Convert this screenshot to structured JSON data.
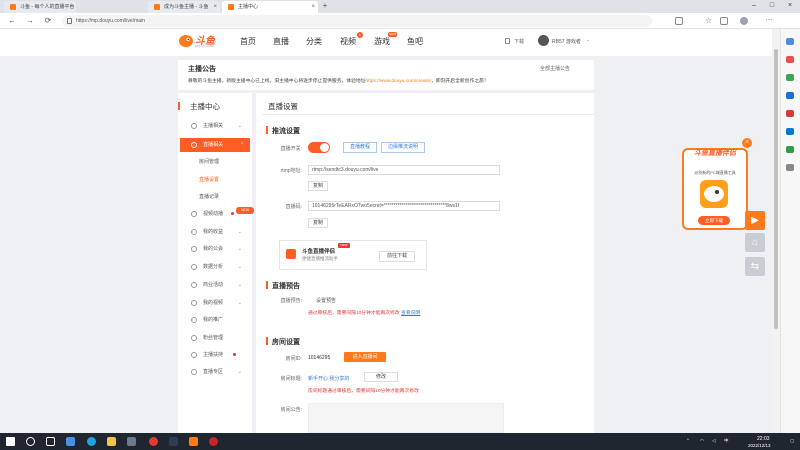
{
  "browser": {
    "tabs": [
      {
        "label": "斗鱼 - 每个人的直播平台"
      },
      {
        "label": "成为斗鱼主播 - 斗鱼"
      },
      {
        "label": "主播中心"
      }
    ],
    "url": "https://mp.douyu.com/live/main",
    "download_label": "下载",
    "profile_label": "RB57 游戏者"
  },
  "site": {
    "logo_text": "斗鱼",
    "logo_sub": "DOUYU.COM",
    "nav": [
      {
        "label": "首页"
      },
      {
        "label": "直播"
      },
      {
        "label": "分类"
      },
      {
        "label": "视频",
        "badge": "6"
      },
      {
        "label": "游戏",
        "badge": "NEW"
      },
      {
        "label": "鱼吧"
      }
    ]
  },
  "announcement": {
    "title": "主播公告",
    "text": "尊敬的斗鱼主播，新版主播中心已上线，旧主播中心将逐步停止提供服务，体验地址",
    "link": "https://www.douyu.com/creator",
    "tail": "，即刻开启全新创作之旅！",
    "view_all": "全部主播公告"
  },
  "sidebar": {
    "title": "主播中心",
    "items": [
      {
        "label": "主播相关",
        "icon": "user-icon"
      },
      {
        "label": "直播相关",
        "icon": "live-icon",
        "active": true
      },
      {
        "label": "视频动播",
        "icon": "video-icon"
      },
      {
        "label": "我的收益",
        "icon": "coin-icon"
      },
      {
        "label": "我的公会",
        "icon": "guild-icon"
      },
      {
        "label": "数据分析",
        "icon": "chart-icon"
      },
      {
        "label": "商业活动",
        "icon": "gift-icon"
      },
      {
        "label": "我的视频",
        "icon": "film-icon"
      },
      {
        "label": "我的推广",
        "icon": "promo-icon"
      },
      {
        "label": "粉丝管理",
        "icon": "fans-icon"
      },
      {
        "label": "主播扶持",
        "icon": "support-icon"
      },
      {
        "label": "直播专区",
        "icon": "zone-icon"
      }
    ],
    "subitems": [
      {
        "label": "房间管理"
      },
      {
        "label": "直播设置",
        "active": true
      },
      {
        "label": "直播记录"
      }
    ],
    "new_badge": "NEW"
  },
  "main": {
    "page_title": "直播设置",
    "push": {
      "title": "推流设置",
      "switch_label": "直播开关:",
      "btn_live_guide": "直播教程",
      "btn_obs_guide": "边缘推流说明",
      "rtmp_label": "rtmp地址:",
      "rtmp_value": "rtmp://sendtc3.douyu.com/live",
      "copy": "复制",
      "code_label": "直播码:",
      "code_value": "10146295rTeEARxO7wo5ecret=********************************8ws1f",
      "assistant_name": "斗鱼直播伴侣",
      "assistant_new": "NEW",
      "assistant_desc": "便捷直播推流助手",
      "assistant_download": "前往下载"
    },
    "preview": {
      "title": "直播预告",
      "label": "直播预告:",
      "value": "设置预告",
      "warn": "通过审核后，需要间隔10分钟才能再次修改",
      "link": "查看说明"
    },
    "room": {
      "title": "房间设置",
      "id_label": "房间ID:",
      "id_value": "10146295",
      "enter_btn": "进入直播间",
      "name_label": "房间标题:",
      "name_value": "新手开心 我分享的",
      "edit_btn": "修改",
      "name_warn": "房间标题通过审核后，需要间隔10分钟才能再次修改",
      "notice_label": "房间公告:"
    }
  },
  "promo": {
    "title": "斗鱼直播伴侣",
    "subtitle": "派别新的PC端直播工具",
    "button": "立即下载"
  },
  "taskbar": {
    "time": "22:03",
    "date": "2022/12/13"
  },
  "colors": {
    "accent": "#ff5d23",
    "link": "#3a7bd5",
    "warn": "#e53935"
  }
}
